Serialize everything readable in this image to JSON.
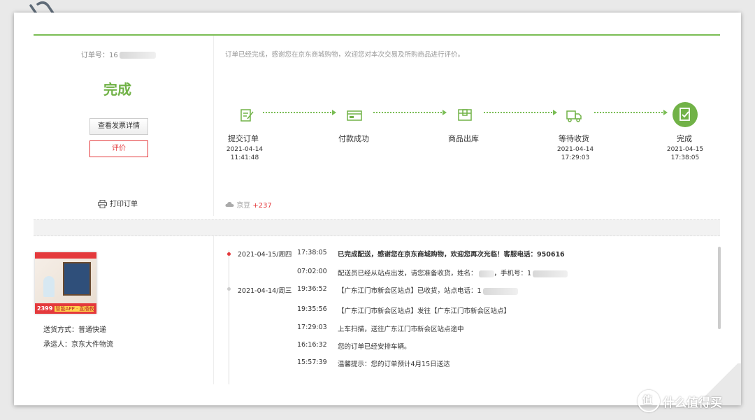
{
  "order": {
    "number_label": "订单号：",
    "number_visible": "16",
    "status": "完成",
    "invoice_button": "查看发票详情",
    "review_button": "评价",
    "print_label": "打印订单",
    "thanks": "订单已经完成，感谢您在京东商城购物，欢迎您对本次交易及所购商品进行评价。"
  },
  "progress": {
    "steps": [
      {
        "label": "提交订单",
        "date": "2021-04-14",
        "time": "11:41:48",
        "icon": "edit-order-icon"
      },
      {
        "label": "付款成功",
        "date": "",
        "time": "",
        "icon": "payment-card-icon"
      },
      {
        "label": "商品出库",
        "date": "",
        "time": "",
        "icon": "package-box-icon"
      },
      {
        "label": "等待收货",
        "date": "2021-04-14",
        "time": "17:29:03",
        "icon": "delivery-truck-icon"
      },
      {
        "label": "完成",
        "date": "2021-04-15",
        "time": "17:38:05",
        "icon": "completed-check-icon"
      }
    ],
    "accent_color": "#71b247"
  },
  "jd_bean": {
    "label": "京豆",
    "value": "+237"
  },
  "shipping": {
    "method": "送货方式：普通快递",
    "carrier": "承运人：京东大件物流",
    "product_badge_price": "2399",
    "product_badge_text": "智能APP · 直播教学"
  },
  "tracking": [
    {
      "date": "2021-04-15/周四",
      "time": "17:38:05",
      "text": "已完成配送，感谢您在京东商城购物，欢迎您再次光临！客服电话：950616",
      "bold": true,
      "dot": "red"
    },
    {
      "date": "",
      "time": "07:02:00",
      "text": "配送员已经从站点出发，请您准备收货，姓名：",
      "text2": "，手机号：1",
      "bold": false,
      "dot": ""
    },
    {
      "date": "2021-04-14/周三",
      "time": "19:36:52",
      "text": "【广东江门市新会区站点】已收货，站点电话：1",
      "bold": false,
      "dot": "gray"
    },
    {
      "date": "",
      "time": "19:35:56",
      "text": "【广东江门市新会区站点】发往【广东江门市新会区站点】",
      "bold": false,
      "dot": ""
    },
    {
      "date": "",
      "time": "17:29:03",
      "text": "上车扫描，送往广东江门市新会区站点途中",
      "bold": false,
      "dot": ""
    },
    {
      "date": "",
      "time": "16:16:32",
      "text": "您的订单已经安排车辆。",
      "bold": false,
      "dot": ""
    },
    {
      "date": "",
      "time": "15:57:39",
      "text": "温馨提示：您的订单预计4月15日送达",
      "bold": false,
      "dot": ""
    }
  ],
  "watermark": {
    "icon": "值",
    "text": "什么值得买"
  }
}
